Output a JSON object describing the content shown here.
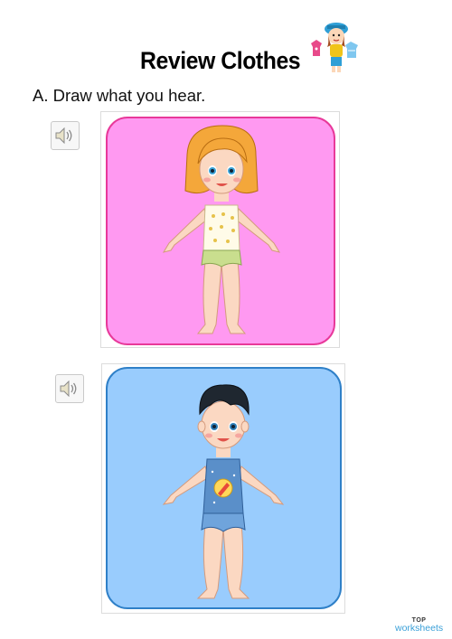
{
  "worksheet": {
    "title": "Review Clothes",
    "instruction": "A. Draw what you hear."
  },
  "exercises": [
    {
      "audio_icon": "speaker-icon",
      "card_color": "#ff99f1",
      "card_border": "#e8399a",
      "figure": "girl"
    },
    {
      "audio_icon": "speaker-icon",
      "card_color": "#99ccfd",
      "card_border": "#2f80c8",
      "figure": "boy"
    }
  ],
  "footer": {
    "logo_top": "TOP",
    "logo_bottom": "worksheets"
  }
}
